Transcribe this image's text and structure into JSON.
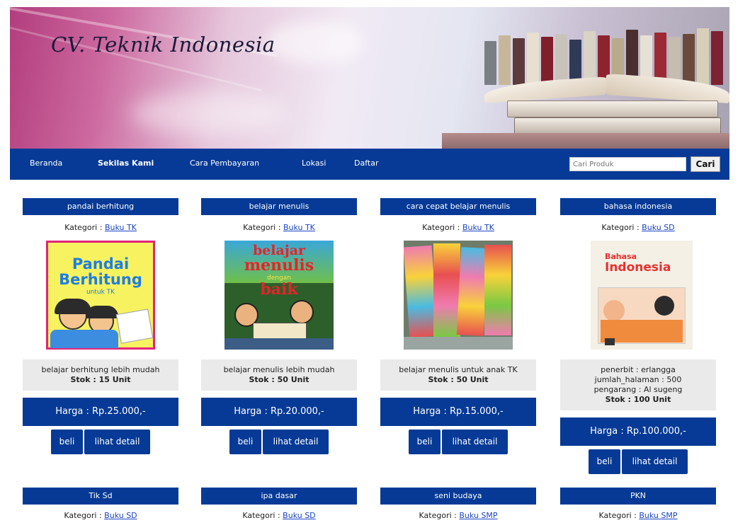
{
  "header": {
    "site_title": "CV. Teknik Indonesia"
  },
  "nav": {
    "items": [
      "Beranda",
      "Sekilas Kami",
      "Cara Pembayaran",
      "Lokasi",
      "Daftar"
    ],
    "search_placeholder": "Cari Produk",
    "search_button": "Cari"
  },
  "labels": {
    "kategori": "Kategori :",
    "harga": "Harga :",
    "beli": "beli",
    "detail": "lihat detail"
  },
  "products": [
    {
      "title": "pandai berhitung",
      "category": "Buku TK",
      "cover_text": [
        "Pandai",
        "Berhitung",
        "untuk TK"
      ],
      "description": "belajar berhitung lebih mudah",
      "stock": "Stok : 15 Unit",
      "price": "Rp.25.000,-"
    },
    {
      "title": "belajar menulis",
      "category": "Buku TK",
      "cover_text": [
        "belajar",
        "menulis",
        "dengan",
        "baik"
      ],
      "description": "belajar menulis lebih mudah",
      "stock": "Stok : 50 Unit",
      "price": "Rp.20.000,-"
    },
    {
      "title": "cara cepat belajar menulis",
      "category": "Buku TK",
      "cover_text": [],
      "description": "belajar menulis untuk anak TK",
      "stock": "Stok : 50 Unit",
      "price": "Rp.15.000,-"
    },
    {
      "title": "bahasa indonesia",
      "category": "Buku SD",
      "cover_text": [
        "Bahasa",
        "Indonesia"
      ],
      "description_lines": [
        "penerbit : erlangga",
        "jumlah_halaman : 500",
        "pengarang : Al sugeng"
      ],
      "stock": "Stok : 100 Unit",
      "price": "Rp.100.000,-"
    }
  ],
  "products_row2": [
    {
      "title": "Tik Sd",
      "category": "Buku SD"
    },
    {
      "title": "ipa dasar",
      "category": "Buku SD"
    },
    {
      "title": "seni budaya",
      "category": "Buku SMP"
    },
    {
      "title": "PKN",
      "category": "Buku SMP"
    }
  ],
  "colors": {
    "primary": "#063a96",
    "link": "#1a44c4",
    "desc_bg": "#eaeaea"
  }
}
